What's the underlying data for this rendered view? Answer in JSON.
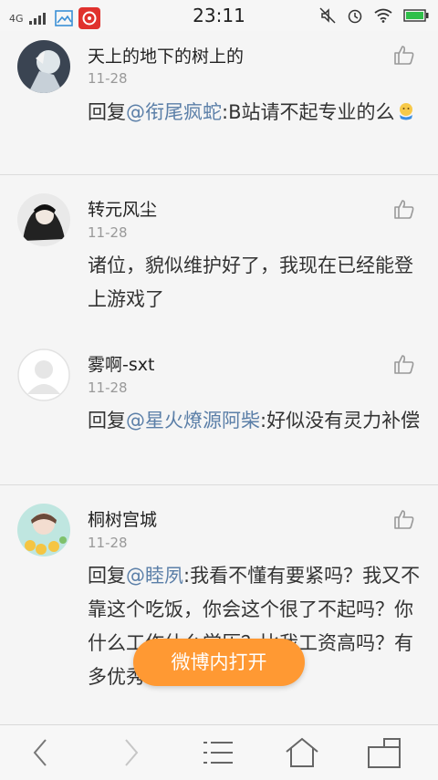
{
  "status_bar": {
    "network": "4G",
    "time": "23:11"
  },
  "comments": [
    {
      "username": "天上的地下的树上的",
      "date": "11-28",
      "reply_prefix": "回复",
      "mention": "@衔尾疯蛇",
      "text": ":B站请不起专业的么",
      "has_emoji": true
    },
    {
      "username": "转元风尘",
      "date": "11-28",
      "text": "诸位，貌似维护好了，我现在已经能登上游戏了"
    },
    {
      "username": "雾啊-sxt",
      "date": "11-28",
      "reply_prefix": "回复",
      "mention": "@星火燎源阿柴",
      "text": ":好似没有灵力补偿"
    },
    {
      "username": "桐树宫城",
      "date": "11-28",
      "reply_prefix": "回复",
      "mention": "@睦夙",
      "text": ":我看不懂有要紧吗？我又不靠这个吃饭，你会这个很了不起吗？你什么工作什么学历？比我工资高吗？有多优秀？"
    }
  ],
  "open_button": {
    "label": "微博内打开"
  },
  "colors": {
    "accent": "#ff9933",
    "mention": "#5b7fa8",
    "date": "#999999"
  },
  "icons": {
    "like": "thumbs-up-icon",
    "back": "chevron-left-icon",
    "forward": "chevron-right-icon",
    "menu": "menu-icon",
    "home": "home-icon",
    "tabs": "tabs-icon"
  }
}
